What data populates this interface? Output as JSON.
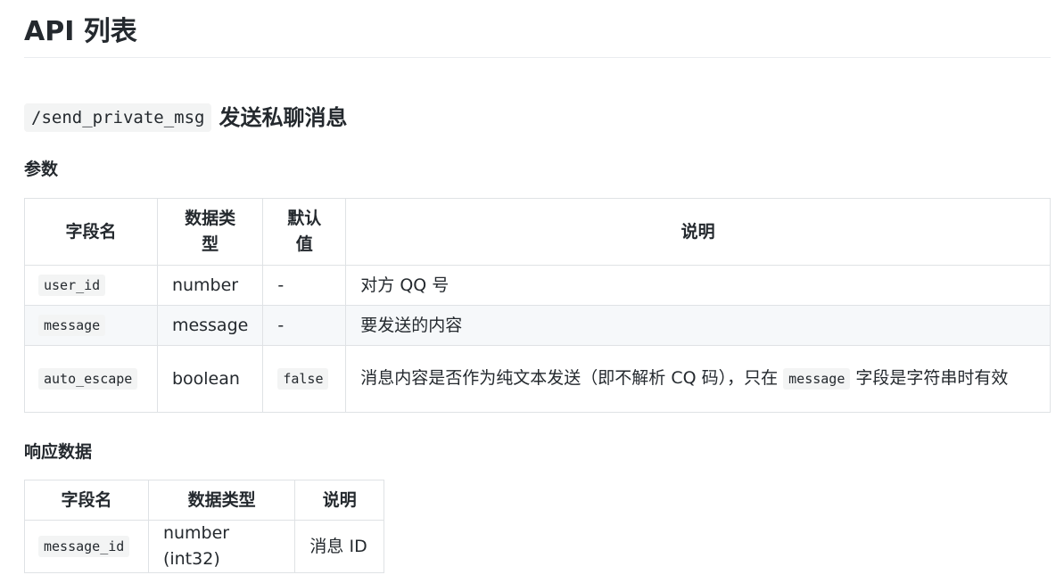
{
  "page_title": "API 列表",
  "endpoint": {
    "path": "/send_private_msg",
    "title": "发送私聊消息"
  },
  "params_heading": "参数",
  "params_table": {
    "headers": [
      "字段名",
      "数据类型",
      "默认值",
      "说明"
    ],
    "rows": [
      {
        "field": "user_id",
        "type": "number",
        "default": "-",
        "desc": "对方 QQ 号"
      },
      {
        "field": "message",
        "type": "message",
        "default": "-",
        "desc": "要发送的内容"
      },
      {
        "field": "auto_escape",
        "type": "boolean",
        "default": "false",
        "desc_before": "消息内容是否作为纯文本发送（即不解析 CQ 码），只在",
        "desc_code": "message",
        "desc_after": "字段是字符串时有效"
      }
    ]
  },
  "response_heading": "响应数据",
  "response_table": {
    "headers": [
      "字段名",
      "数据类型",
      "说明"
    ],
    "rows": [
      {
        "field": "message_id",
        "type": "number (int32)",
        "desc": "消息 ID"
      }
    ]
  }
}
